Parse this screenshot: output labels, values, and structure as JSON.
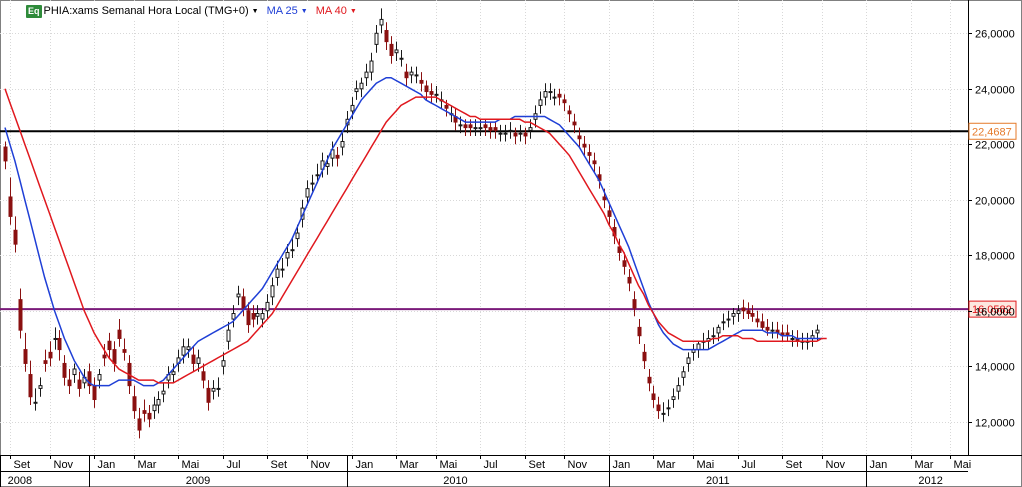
{
  "legend": {
    "badge": "Eq",
    "symbol": "PHIA:xams Semanal Hora Local (TMG+0)",
    "ma25": "MA 25",
    "ma40": "MA 40"
  },
  "colors": {
    "up_candle": "#1a1a1a",
    "down_candle": "#8a1010",
    "ma25": "#1f3fd6",
    "ma40": "#e0181e",
    "resistance_line": "#000000",
    "support_line": "#7a1a7a",
    "resistance_label": "#e57a2a",
    "support_label": "#e0181e",
    "grid": "#d8d8d8"
  },
  "chart_data": {
    "type": "candlestick",
    "title": "PHIA:xams Semanal Hora Local (TMG+0)",
    "ylim": [
      10.8,
      27.2
    ],
    "y_ticks": [
      "12,0000",
      "14,0000",
      "16,0000",
      "18,0000",
      "20,0000",
      "22,0000",
      "24,0000",
      "26,0000"
    ],
    "y_tick_values": [
      12,
      14,
      16,
      18,
      20,
      22,
      24,
      26
    ],
    "x_month_labels": [
      "Set",
      "Nov",
      "Jan",
      "Mar",
      "Mai",
      "Jul",
      "Set",
      "Nov",
      "Jan",
      "Mar",
      "Mai",
      "Jul",
      "Set",
      "Nov",
      "Jan",
      "Mar",
      "Mai",
      "Jul",
      "Set",
      "Nov",
      "Jan",
      "Mar",
      "Mai"
    ],
    "x_month_weeks": [
      1,
      9,
      18,
      26,
      35,
      44,
      53,
      61,
      70,
      79,
      87,
      96,
      105,
      113,
      122,
      131,
      139,
      148,
      157,
      165,
      174,
      183,
      191
    ],
    "x_year_labels": [
      "2008",
      "2009",
      "2010",
      "2011",
      "2012"
    ],
    "x_year_weeks": [
      -1,
      17,
      69,
      122,
      174
    ],
    "x_year_label_weeks": [
      3,
      39,
      91,
      144,
      187
    ],
    "horizontal_lines": [
      {
        "value": 22.4687,
        "label": "22,4687",
        "role": "resistance"
      },
      {
        "value": 16.0582,
        "label": "16,0582",
        "role": "support"
      }
    ],
    "candles": {
      "close": [
        21.4,
        19.4,
        18.4,
        15.3,
        14.1,
        12.9,
        12.7,
        13.3,
        14.1,
        14.3,
        15.0,
        14.6,
        13.6,
        13.3,
        13.9,
        13.2,
        13.6,
        13.3,
        12.8,
        13.7,
        14.3,
        14.6,
        14.1,
        15.0,
        14.5,
        13.3,
        12.4,
        11.7,
        12.3,
        12.1,
        12.6,
        12.8,
        13.1,
        13.7,
        13.8,
        14.3,
        14.7,
        14.7,
        14.1,
        14.3,
        13.5,
        12.7,
        13.2,
        13.2,
        14.2,
        15.3,
        15.9,
        16.6,
        16.1,
        15.5,
        15.7,
        15.9,
        15.9,
        16.3,
        16.9,
        17.5,
        17.5,
        18.1,
        18.2,
        18.8,
        19.7,
        20.4,
        20.6,
        20.9,
        21.4,
        21.3,
        21.8,
        21.5,
        22.1,
        22.9,
        23.4,
        24.0,
        24.2,
        24.6,
        25.0,
        26.0,
        26.5,
        25.7,
        25.2,
        25.4,
        25.1,
        24.4,
        24.6,
        24.5,
        24.2,
        23.9,
        23.8,
        23.8,
        23.6,
        23.3,
        23.1,
        22.8,
        22.7,
        22.6,
        22.6,
        22.6,
        22.6,
        22.6,
        22.5,
        22.5,
        22.4,
        22.4,
        22.5,
        22.3,
        22.4,
        22.3,
        22.6,
        23.1,
        23.6,
        23.9,
        23.9,
        23.7,
        23.7,
        23.5,
        23.1,
        22.7,
        22.2,
        21.9,
        21.6,
        21.3,
        20.7,
        20.0,
        19.4,
        18.7,
        18.1,
        17.6,
        17.0,
        16.1,
        15.1,
        14.2,
        13.4,
        12.8,
        12.4,
        12.3,
        12.5,
        12.9,
        13.3,
        13.8,
        14.3,
        14.6,
        14.8,
        14.9,
        15.0,
        15.1,
        15.4,
        15.6,
        15.7,
        15.9,
        16.0,
        16.0,
        15.9,
        15.8,
        15.6,
        15.4,
        15.3,
        15.3,
        15.2,
        15.1,
        15.1,
        15.0,
        14.9,
        14.9,
        14.9,
        15.1,
        15.3
      ],
      "open": [
        21.9,
        20.1,
        18.9,
        16.4,
        14.6,
        13.7,
        12.7,
        13.2,
        14.2,
        14.5,
        15.0,
        15.0,
        14.1,
        13.5,
        13.7,
        13.5,
        13.4,
        13.8,
        13.3,
        13.5,
        14.4,
        14.9,
        14.6,
        15.3,
        14.6,
        14.1,
        12.9,
        12.1,
        12.4,
        12.3,
        12.4,
        12.6,
        13.0,
        13.5,
        13.7,
        14.1,
        14.4,
        14.6,
        14.4,
        14.1,
        13.8,
        13.2,
        13.1,
        13.2,
        14.0,
        14.9,
        15.7,
        16.5,
        16.5,
        16.0,
        15.9,
        15.8,
        15.7,
        16.0,
        16.5,
        17.2,
        17.5,
        17.9,
        18.2,
        18.6,
        19.3,
        20.1,
        20.6,
        20.9,
        21.1,
        21.2,
        21.5,
        21.6,
        21.9,
        22.7,
        23.2,
        23.9,
        24.0,
        24.4,
        24.6,
        25.6,
        26.3,
        26.1,
        25.6,
        25.3,
        25.1,
        24.6,
        24.5,
        24.5,
        24.3,
        24.1,
        23.9,
        23.8,
        23.6,
        23.4,
        23.1,
        23.0,
        22.7,
        22.7,
        22.7,
        22.6,
        22.6,
        22.7,
        22.6,
        22.6,
        22.4,
        22.4,
        22.5,
        22.4,
        22.4,
        22.4,
        22.5,
        22.9,
        23.4,
        23.7,
        23.9,
        23.7,
        23.8,
        23.6,
        23.2,
        22.8,
        22.3,
        22.0,
        21.7,
        21.4,
        20.9,
        20.1,
        19.6,
        19.0,
        18.3,
        17.8,
        17.2,
        16.4,
        15.4,
        14.5,
        13.6,
        13.0,
        12.6,
        12.3,
        12.5,
        12.8,
        13.1,
        13.6,
        14.1,
        14.5,
        14.6,
        14.9,
        14.9,
        15.1,
        15.2,
        15.6,
        15.7,
        15.8,
        15.9,
        16.1,
        16.0,
        15.9,
        15.7,
        15.6,
        15.4,
        15.3,
        15.3,
        15.2,
        15.2,
        15.0,
        15.0,
        14.9,
        14.9,
        15.0,
        15.2
      ],
      "high": [
        22.1,
        20.8,
        19.4,
        16.8,
        15.2,
        14.2,
        13.2,
        13.6,
        14.6,
        14.9,
        15.4,
        15.3,
        14.4,
        13.9,
        14.1,
        13.8,
        13.9,
        14.1,
        13.6,
        13.9,
        14.8,
        15.2,
        14.9,
        15.7,
        15.0,
        14.4,
        13.3,
        12.5,
        12.8,
        12.6,
        12.9,
        13.1,
        13.4,
        14.0,
        14.1,
        14.6,
        15.0,
        15.0,
        14.7,
        14.6,
        14.1,
        13.5,
        13.5,
        13.6,
        14.5,
        15.6,
        16.2,
        16.9,
        16.8,
        16.3,
        16.2,
        16.2,
        16.1,
        16.6,
        17.2,
        17.8,
        17.9,
        18.4,
        18.6,
        19.1,
        20.0,
        20.7,
        20.9,
        21.3,
        21.7,
        21.6,
        22.1,
        21.9,
        22.4,
        23.2,
        23.7,
        24.3,
        24.4,
        24.9,
        25.3,
        26.3,
        26.9,
        26.4,
        25.9,
        25.7,
        25.4,
        24.9,
        24.8,
        24.8,
        24.6,
        24.3,
        24.2,
        24.1,
        23.9,
        23.6,
        23.4,
        23.3,
        23.0,
        22.9,
        22.9,
        22.9,
        22.9,
        22.9,
        22.8,
        22.8,
        22.7,
        22.7,
        22.8,
        22.6,
        22.7,
        22.6,
        22.9,
        23.4,
        23.9,
        24.2,
        24.2,
        24.0,
        24.0,
        23.8,
        23.4,
        23.1,
        22.6,
        22.3,
        22.0,
        21.7,
        21.2,
        20.4,
        19.9,
        19.3,
        18.6,
        18.1,
        17.5,
        16.7,
        15.7,
        14.8,
        13.9,
        13.3,
        12.9,
        12.7,
        12.8,
        13.2,
        13.6,
        14.0,
        14.5,
        14.8,
        14.9,
        15.2,
        15.3,
        15.4,
        15.5,
        15.9,
        16.0,
        16.1,
        16.2,
        16.4,
        16.3,
        16.2,
        16.0,
        15.9,
        15.7,
        15.6,
        15.6,
        15.5,
        15.5,
        15.3,
        15.3,
        15.2,
        15.2,
        15.3,
        15.5
      ],
      "low": [
        21.1,
        19.1,
        18.1,
        15.0,
        13.8,
        12.6,
        12.4,
        12.9,
        13.8,
        14.0,
        14.6,
        14.2,
        13.3,
        13.0,
        13.4,
        12.9,
        13.2,
        13.0,
        12.5,
        13.2,
        14.0,
        14.3,
        13.8,
        14.7,
        14.2,
        13.0,
        12.1,
        11.4,
        12.0,
        11.8,
        12.1,
        12.3,
        12.7,
        13.2,
        13.4,
        13.8,
        14.1,
        14.3,
        13.8,
        13.8,
        13.2,
        12.4,
        12.8,
        12.9,
        13.7,
        14.6,
        15.4,
        16.2,
        15.8,
        15.2,
        15.4,
        15.5,
        15.4,
        15.7,
        16.2,
        16.9,
        17.2,
        17.6,
        17.9,
        18.3,
        19.0,
        19.8,
        20.3,
        20.6,
        20.8,
        20.9,
        21.2,
        21.2,
        21.6,
        22.4,
        22.9,
        23.6,
        23.7,
        24.1,
        24.3,
        25.3,
        26.0,
        25.4,
        24.9,
        25.0,
        24.8,
        24.1,
        24.2,
        24.2,
        23.9,
        23.6,
        23.5,
        23.5,
        23.3,
        23.0,
        22.8,
        22.5,
        22.4,
        22.3,
        22.3,
        22.3,
        22.3,
        22.3,
        22.2,
        22.2,
        22.1,
        22.1,
        22.2,
        22.0,
        22.1,
        22.0,
        22.2,
        22.6,
        23.1,
        23.4,
        23.6,
        23.4,
        23.4,
        23.2,
        22.8,
        22.4,
        21.9,
        21.6,
        21.3,
        21.0,
        20.4,
        19.7,
        19.1,
        18.4,
        17.8,
        17.3,
        16.7,
        15.8,
        14.8,
        13.9,
        13.1,
        12.5,
        12.1,
        12.0,
        12.2,
        12.5,
        12.8,
        13.3,
        13.8,
        14.2,
        14.3,
        14.6,
        14.6,
        14.8,
        14.9,
        15.3,
        15.4,
        15.5,
        15.6,
        15.7,
        15.7,
        15.6,
        15.4,
        15.3,
        15.1,
        15.0,
        15.0,
        14.9,
        14.9,
        14.7,
        14.7,
        14.6,
        14.6,
        14.7,
        14.9
      ]
    },
    "series": [
      {
        "name": "MA 25",
        "values": [
          22.6,
          22.0,
          21.4,
          20.7,
          20.0,
          19.3,
          18.6,
          17.9,
          17.2,
          16.6,
          16.0,
          15.5,
          15.0,
          14.6,
          14.2,
          13.9,
          13.6,
          13.4,
          13.3,
          13.3,
          13.3,
          13.3,
          13.4,
          13.5,
          13.5,
          13.5,
          13.5,
          13.4,
          13.3,
          13.3,
          13.3,
          13.4,
          13.5,
          13.7,
          13.9,
          14.1,
          14.3,
          14.5,
          14.7,
          14.9,
          15.0,
          15.1,
          15.2,
          15.3,
          15.4,
          15.5,
          15.6,
          15.8,
          16.0,
          16.2,
          16.4,
          16.6,
          16.8,
          17.1,
          17.4,
          17.7,
          18.0,
          18.3,
          18.6,
          19.0,
          19.4,
          19.8,
          20.2,
          20.6,
          21.0,
          21.4,
          21.8,
          22.1,
          22.4,
          22.7,
          23.0,
          23.3,
          23.6,
          23.8,
          24.0,
          24.2,
          24.3,
          24.4,
          24.4,
          24.3,
          24.2,
          24.1,
          24.0,
          23.9,
          23.8,
          23.6,
          23.5,
          23.4,
          23.3,
          23.2,
          23.1,
          23.0,
          22.9,
          22.8,
          22.8,
          22.8,
          22.8,
          22.8,
          22.8,
          22.8,
          22.9,
          22.9,
          22.9,
          23.0,
          23.0,
          23.0,
          23.0,
          23.0,
          23.0,
          23.0,
          22.9,
          22.8,
          22.7,
          22.5,
          22.3,
          22.1,
          21.9,
          21.6,
          21.3,
          21.0,
          20.7,
          20.3,
          19.9,
          19.5,
          19.1,
          18.7,
          18.3,
          17.8,
          17.3,
          16.8,
          16.3,
          15.9,
          15.5,
          15.2,
          15.0,
          14.8,
          14.7,
          14.6,
          14.6,
          14.6,
          14.6,
          14.6,
          14.6,
          14.7,
          14.8,
          14.9,
          15.0,
          15.1,
          15.2,
          15.3,
          15.3,
          15.3,
          15.3,
          15.3,
          15.2,
          15.2,
          15.2,
          15.1,
          15.1,
          15.1,
          15.0,
          15.0,
          15.0,
          15.0,
          15.0,
          15.0
        ]
      },
      {
        "name": "MA 40",
        "values": [
          24.0,
          23.5,
          23.0,
          22.5,
          22.0,
          21.5,
          21.0,
          20.5,
          20.0,
          19.5,
          19.0,
          18.5,
          18.0,
          17.5,
          17.0,
          16.5,
          16.0,
          15.6,
          15.2,
          14.9,
          14.6,
          14.3,
          14.1,
          13.9,
          13.8,
          13.7,
          13.6,
          13.5,
          13.5,
          13.5,
          13.5,
          13.4,
          13.4,
          13.4,
          13.4,
          13.5,
          13.6,
          13.7,
          13.8,
          13.9,
          14.0,
          14.1,
          14.2,
          14.3,
          14.4,
          14.5,
          14.6,
          14.7,
          14.8,
          14.9,
          15.1,
          15.3,
          15.5,
          15.7,
          15.9,
          16.2,
          16.5,
          16.8,
          17.1,
          17.4,
          17.7,
          18.0,
          18.3,
          18.6,
          18.9,
          19.2,
          19.5,
          19.8,
          20.1,
          20.4,
          20.7,
          21.0,
          21.3,
          21.6,
          21.9,
          22.2,
          22.5,
          22.8,
          23.0,
          23.2,
          23.4,
          23.5,
          23.6,
          23.7,
          23.7,
          23.7,
          23.7,
          23.7,
          23.6,
          23.5,
          23.4,
          23.3,
          23.2,
          23.1,
          23.0,
          23.0,
          22.9,
          22.9,
          22.9,
          22.9,
          22.9,
          22.9,
          22.9,
          22.9,
          22.9,
          22.8,
          22.8,
          22.7,
          22.6,
          22.5,
          22.4,
          22.2,
          22.0,
          21.8,
          21.6,
          21.3,
          21.0,
          20.7,
          20.4,
          20.1,
          19.8,
          19.5,
          19.1,
          18.8,
          18.4,
          18.1,
          17.7,
          17.3,
          16.9,
          16.6,
          16.2,
          15.9,
          15.6,
          15.4,
          15.2,
          15.1,
          15.0,
          14.9,
          14.9,
          14.9,
          14.9,
          14.9,
          14.9,
          15.0,
          15.0,
          15.1,
          15.1,
          15.1,
          15.1,
          15.0,
          15.0,
          15.0,
          14.9,
          14.9,
          14.9,
          14.9,
          14.9,
          14.9,
          14.9,
          14.9,
          14.9,
          14.9,
          14.9,
          14.9,
          14.9,
          15.0,
          15.0
        ]
      }
    ]
  }
}
